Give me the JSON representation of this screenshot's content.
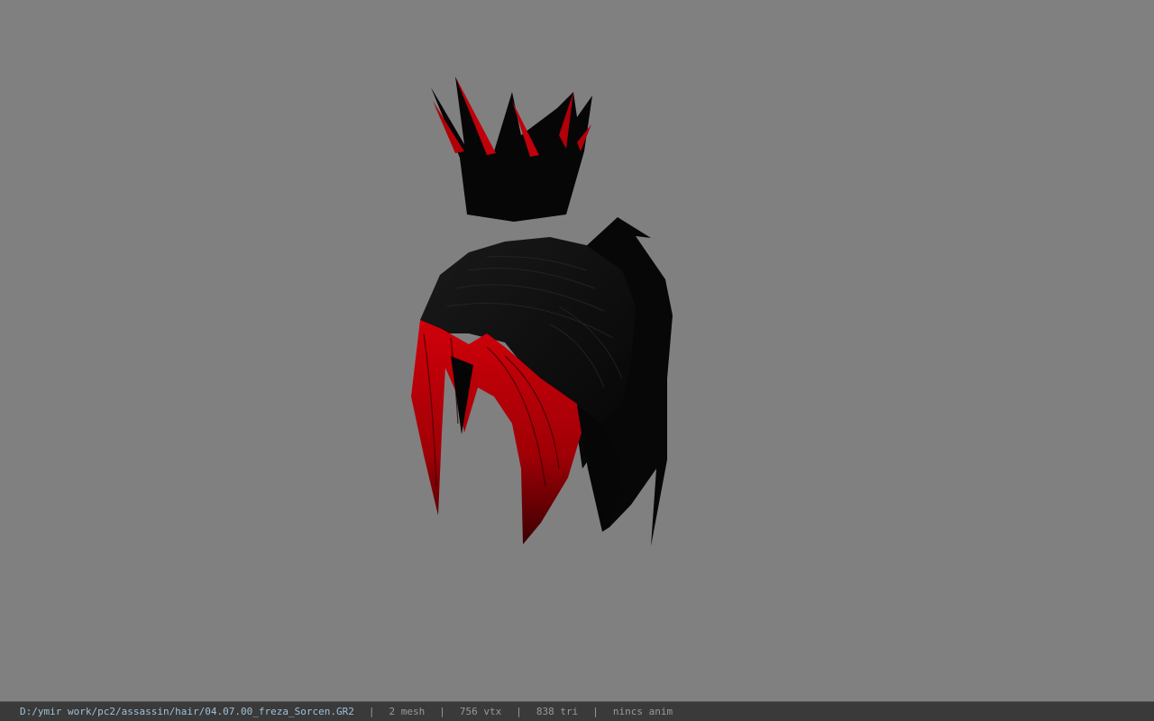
{
  "model_viewer": {
    "model_name": "freza_Sorcen",
    "colors": {
      "background": "#808080",
      "hair_black": "#0a0a0a",
      "hair_red": "#b00008",
      "status_bar": "#3a3a3a",
      "path_text": "#9fc0d8"
    }
  },
  "status_bar": {
    "file_path": "D:/ymir work/pc2/assassin/hair/04.07.00_freza_Sorcen.GR2",
    "separator": "|",
    "mesh_count": "2 mesh",
    "vertex_count": "756 vtx",
    "triangle_count": "838 tri",
    "animation": "nincs anim"
  }
}
